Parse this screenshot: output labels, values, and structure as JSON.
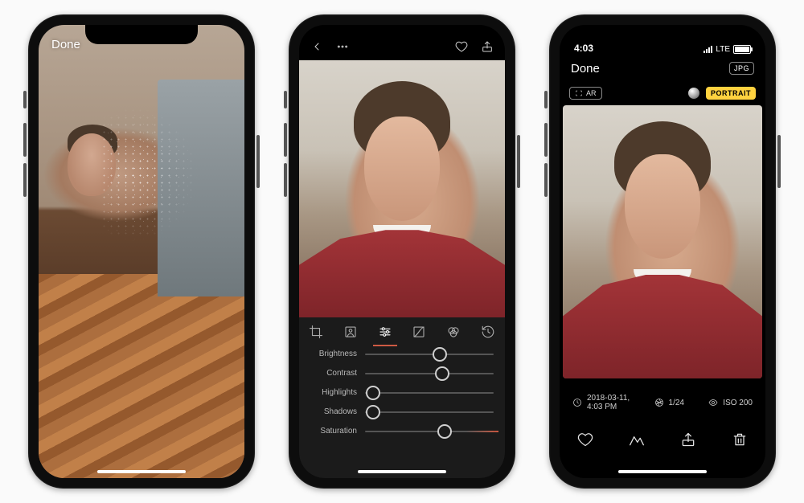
{
  "phone1": {
    "done_label": "Done"
  },
  "phone2": {
    "sliders": {
      "brightness": {
        "label": "Brightness",
        "value": 58
      },
      "contrast": {
        "label": "Contrast",
        "value": 60
      },
      "highlights": {
        "label": "Highlights",
        "value": 6
      },
      "shadows": {
        "label": "Shadows",
        "value": 6
      },
      "saturation": {
        "label": "Saturation",
        "value": 62
      }
    }
  },
  "phone3": {
    "status_time": "4:03",
    "carrier_label": "LTE",
    "done_label": "Done",
    "jpg_badge": "JPG",
    "ar_badge": "AR",
    "portrait_badge": "PORTRAIT",
    "meta": {
      "date": "2018-03-11,",
      "time": "4:03 PM",
      "shutter": "1/24",
      "iso": "ISO 200"
    }
  }
}
